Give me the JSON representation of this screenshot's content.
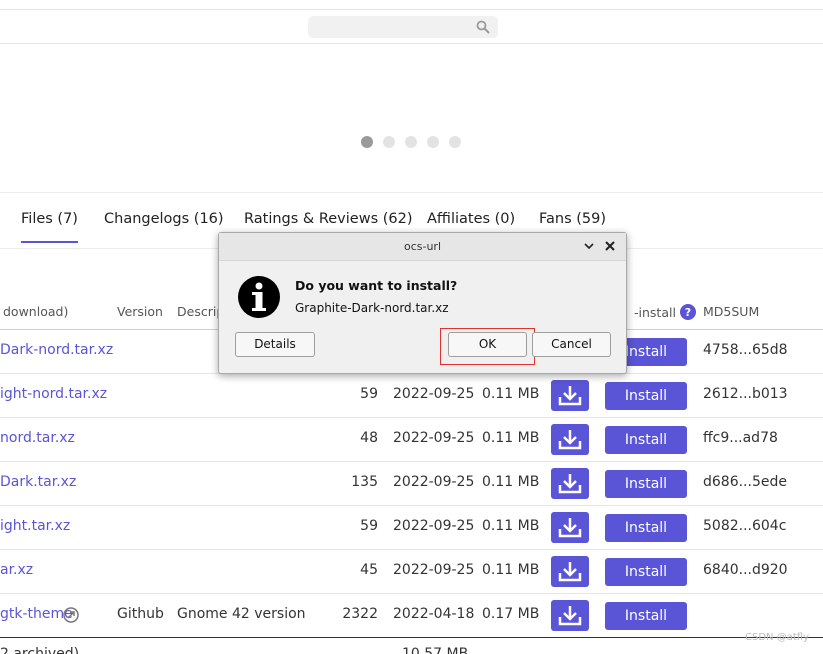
{
  "tabs": [
    {
      "label": "Files (7)",
      "active": true
    },
    {
      "label": "Changelogs (16)"
    },
    {
      "label": "Ratings & Reviews (62)"
    },
    {
      "label": "Affiliates (0)"
    },
    {
      "label": "Fans (59)"
    }
  ],
  "table": {
    "headers": {
      "file": "download)",
      "version": "Version",
      "description": "Descrip",
      "ocs_install": "-install",
      "md5": "MD5SUM"
    },
    "rows": [
      {
        "file": "Dark-nord.tar.xz",
        "version": "",
        "description": "",
        "downloads": "",
        "date": "",
        "size": "",
        "install": "Install",
        "md5": "4758...65d8"
      },
      {
        "file": "ight-nord.tar.xz",
        "version": "",
        "description": "",
        "downloads": "59",
        "date": "2022-09-25",
        "size": "0.11 MB",
        "install": "Install",
        "md5": "2612...b013"
      },
      {
        "file": "nord.tar.xz",
        "version": "",
        "description": "",
        "downloads": "48",
        "date": "2022-09-25",
        "size": "0.11 MB",
        "install": "Install",
        "md5": "ffc9...ad78"
      },
      {
        "file": "Dark.tar.xz",
        "version": "",
        "description": "",
        "downloads": "135",
        "date": "2022-09-25",
        "size": "0.11 MB",
        "install": "Install",
        "md5": "d686...5ede"
      },
      {
        "file": "ight.tar.xz",
        "version": "",
        "description": "",
        "downloads": "59",
        "date": "2022-09-25",
        "size": "0.11 MB",
        "install": "Install",
        "md5": "5082...604c"
      },
      {
        "file": "ar.xz",
        "version": "",
        "description": "",
        "downloads": "45",
        "date": "2022-09-25",
        "size": "0.11 MB",
        "install": "Install",
        "md5": "6840...d920"
      },
      {
        "file": "gtk-theme",
        "version": "Github",
        "description": "Gnome 42 version",
        "downloads": "2322",
        "date": "2022-04-18",
        "size": "0.17 MB",
        "install": "Install",
        "md5": ""
      }
    ],
    "footer_left": "2 archived)",
    "footer_size": "10.57 MB"
  },
  "dialog": {
    "title": "ocs-url",
    "question": "Do you want to install?",
    "filename": "Graphite-Dark-nord.tar.xz",
    "details_label": "Details",
    "ok_label": "OK",
    "cancel_label": "Cancel"
  },
  "watermark": "CSDN @atfly",
  "colors": {
    "accent": "#5a54d6",
    "highlight": "#e03030"
  }
}
